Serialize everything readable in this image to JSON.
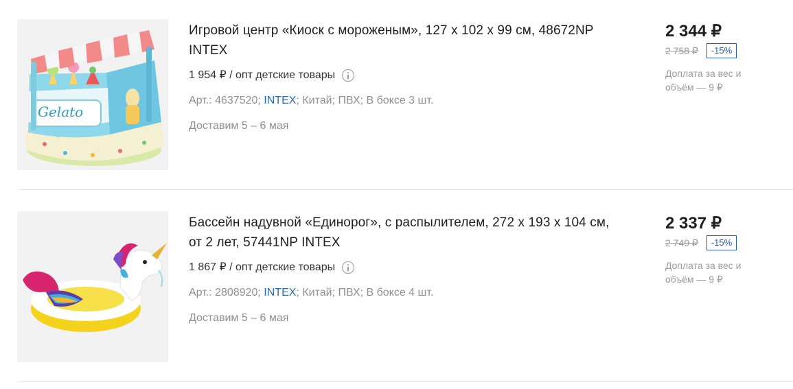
{
  "products": [
    {
      "image_icon": "inflatable-ice-cream-kiosk",
      "title": "Игровой центр «Киоск с мороженым», 127 x 102 x 99 см, 48672NP INTEX",
      "wholesale": "1 954 ₽ / опт детские товары",
      "art_prefix": "Арт.: 4637520; ",
      "brand": "INTEX",
      "attrs_rest": "; Китай; ПВХ; В боксе 3 шт.",
      "delivery": "Доставим 5 – 6 мая",
      "price": "2 344 ₽",
      "old_price": "2 758 ₽",
      "discount": "-15%",
      "surcharge": "Доплата за вес и объём — 9 ₽"
    },
    {
      "image_icon": "inflatable-unicorn-pool",
      "title": "Бассейн надувной «Единорог», с распылителем, 272 x 193 x 104 см, от 2 лет, 57441NP INTEX",
      "wholesale": "1 867 ₽ / опт детские товары",
      "art_prefix": "Арт.: 2808920; ",
      "brand": "INTEX",
      "attrs_rest": "; Китай; ПВХ; В боксе 4 шт.",
      "delivery": "Доставим 5 – 6 мая",
      "price": "2 337 ₽",
      "old_price": "2 749 ₽",
      "discount": "-15%",
      "surcharge": "Доплата за вес и объём — 9 ₽"
    }
  ],
  "colors": {
    "brand_link": "#2a6bb6",
    "discount": "#2a56c6",
    "muted": "#8f8f8f",
    "divider": "#e3e3e3"
  }
}
